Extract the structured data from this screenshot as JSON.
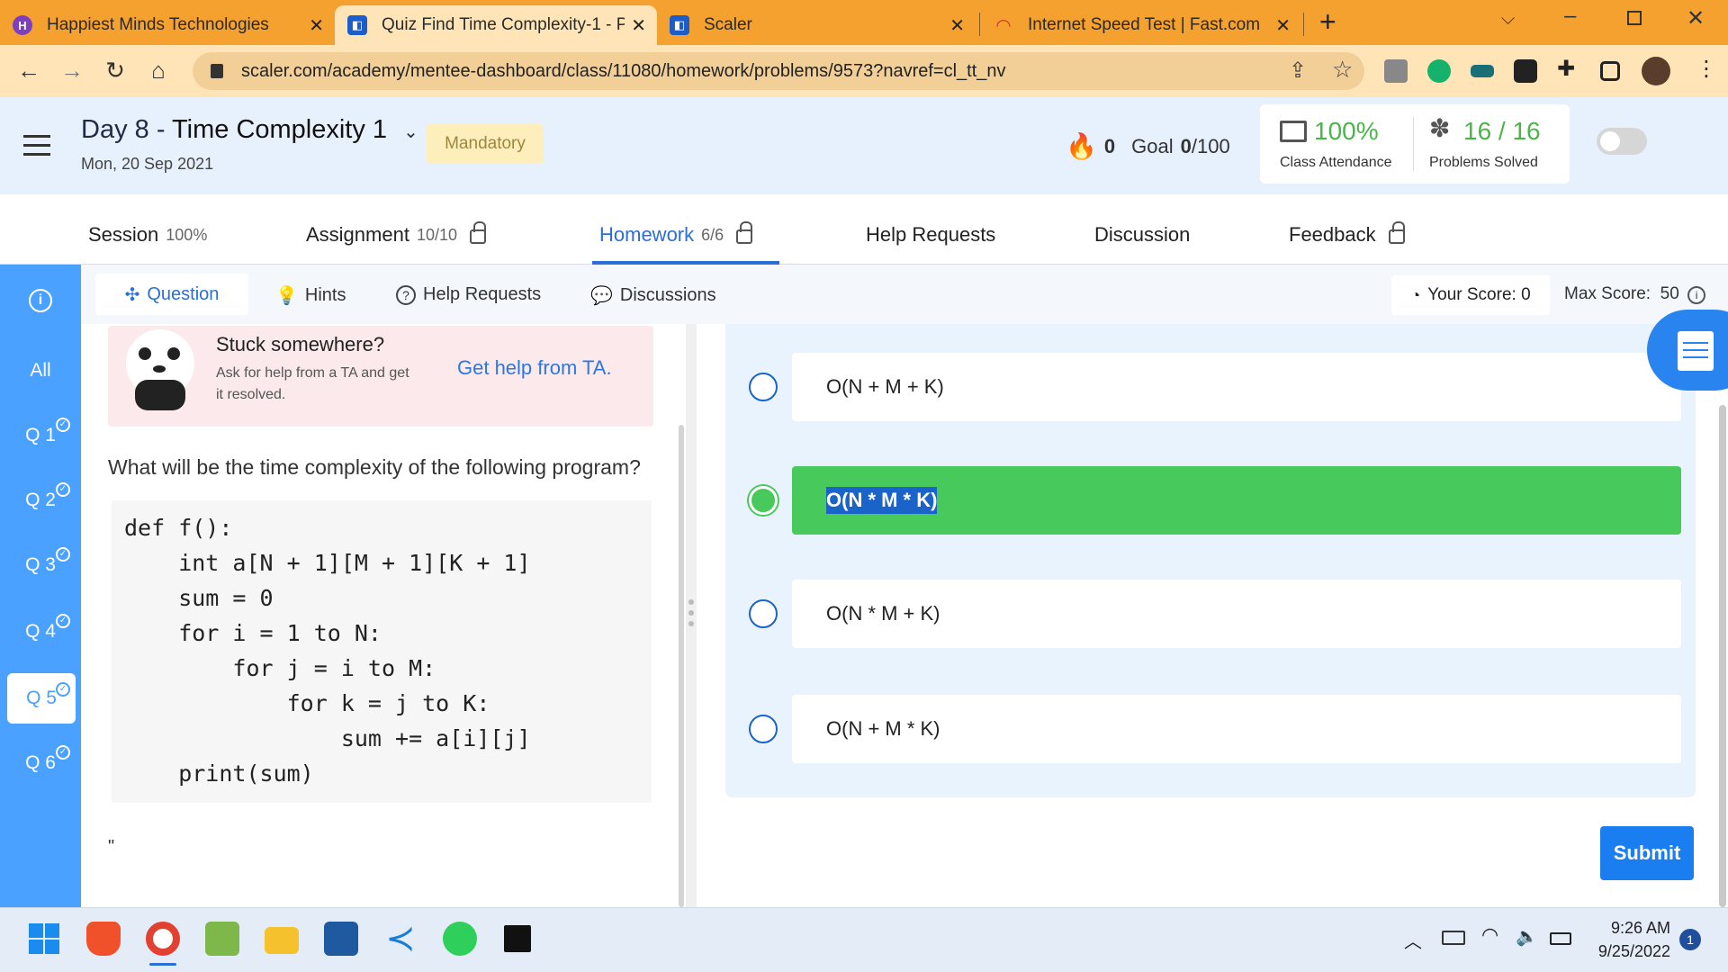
{
  "browser": {
    "tabs": [
      {
        "title": "Happiest Minds Technologies",
        "close": "✕"
      },
      {
        "title": "Quiz Find Time Complexity-1 - Pr",
        "close": "✕"
      },
      {
        "title": "Scaler",
        "close": "✕"
      },
      {
        "title": "Internet Speed Test | Fast.com",
        "close": "✕"
      }
    ],
    "new_tab": "+",
    "url": "scaler.com/academy/mentee-dashboard/class/11080/homework/problems/9573?navref=cl_tt_nv"
  },
  "header": {
    "day_prefix": "Day 8 - ",
    "day_title": "Time Complexity 1",
    "date": "Mon, 20 Sep 2021",
    "badge": "Mandatory",
    "streak": "0",
    "goal_label": "Goal",
    "goal_value": "0",
    "goal_total": "/100",
    "attendance_value": "100%",
    "attendance_label": "Class Attendance",
    "solved_value": "16 / 16",
    "solved_label": "Problems Solved"
  },
  "main_tabs": [
    {
      "label": "Session",
      "meta": "100%"
    },
    {
      "label": "Assignment",
      "meta": "10/10"
    },
    {
      "label": "Homework",
      "meta": "6/6"
    },
    {
      "label": "Help Requests",
      "meta": ""
    },
    {
      "label": "Discussion",
      "meta": ""
    },
    {
      "label": "Feedback",
      "meta": ""
    }
  ],
  "sidebar": {
    "info": "i",
    "all": "All",
    "questions": [
      "Q 1",
      "Q 2",
      "Q 3",
      "Q 4",
      "Q 5",
      "Q 6"
    ],
    "selected": "Q 5"
  },
  "sub_tabs": [
    "Question",
    "Hints",
    "Help Requests",
    "Discussions"
  ],
  "score": {
    "your_score": "Your Score: 0",
    "max_score": "Max Score:  50"
  },
  "stuck": {
    "title": "Stuck somewhere?",
    "desc_line1": "Ask for help from a TA and get",
    "desc_line2": "it resolved.",
    "cta": "Get help from TA."
  },
  "question": {
    "text": "What will be the time complexity of the following program?",
    "code": [
      "def f():",
      "    int a[N + 1][M + 1][K + 1]",
      "    sum = 0",
      "    for i = 1 to N:",
      "        for j = i to M:",
      "            for k = j to K:",
      "                sum += a[i][j]",
      "    print(sum)"
    ],
    "trailing": "\""
  },
  "options": [
    "O(N + M + K)",
    "O(N * M * K)",
    "O(N * M + K)",
    "O(N + M * K)"
  ],
  "selected_option": 1,
  "submit_label": "Submit",
  "taskbar": {
    "time": "9:26 AM",
    "date": "9/25/2022",
    "notifications": "1"
  },
  "colors": {
    "tab_bar": "#f5a12f",
    "sidebar": "#4aa1ff",
    "correct": "#48c95b",
    "accent": "#2a6fd6"
  }
}
